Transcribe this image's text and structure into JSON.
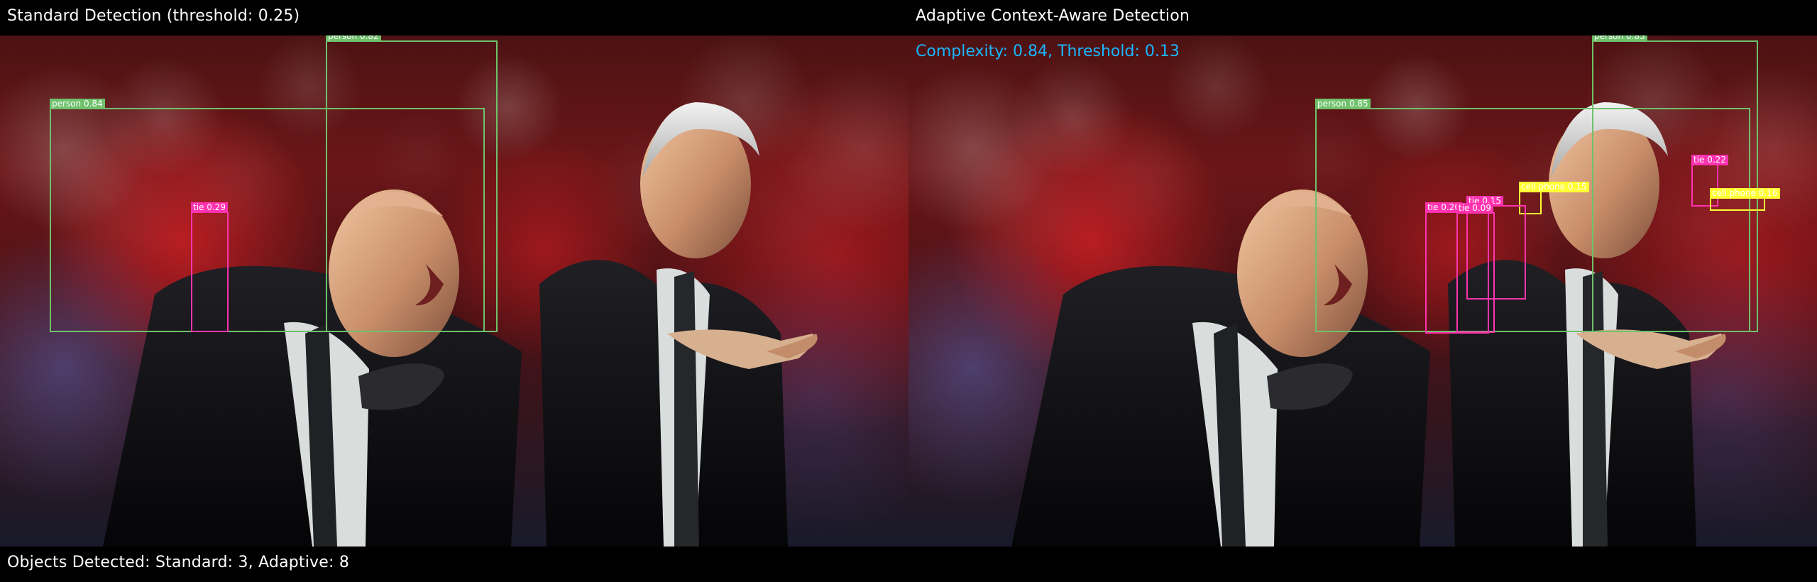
{
  "header": {
    "left_title": "Standard Detection (threshold: 0.25)",
    "right_title": "Adaptive Context-Aware Detection",
    "right_metrics": "Complexity: 0.84, Threshold: 0.13"
  },
  "footer": {
    "summary": "Objects Detected: Standard: 3, Adaptive: 8"
  },
  "standard_detections": [
    {
      "label": "person 0.82",
      "color": "#6fc16b"
    },
    {
      "label": "person 0.84",
      "color": "#6fc16b"
    },
    {
      "label": "tie 0.29",
      "color": "#ff33b0"
    }
  ],
  "adaptive_detections": [
    {
      "label": "person 0.85",
      "color": "#6fc16b"
    },
    {
      "label": "person 0.85",
      "color": "#6fc16b"
    },
    {
      "label": "tie 0.22",
      "color": "#ff33b0"
    },
    {
      "label": "cell phone 0.15",
      "color": "#ffff33"
    },
    {
      "label": "cell phone 0.16",
      "color": "#ffff33"
    },
    {
      "label": "tie 0.15",
      "color": "#ff33b0"
    },
    {
      "label": "tie 0.20",
      "color": "#ff33b0"
    },
    {
      "label": "tie 0.09",
      "color": "#ff33b0"
    }
  ],
  "colors": {
    "person": "#6fc16b",
    "tie": "#ff33b0",
    "cell_phone": "#ffff33",
    "metrics_text": "#19b7ff",
    "text": "#ffffff",
    "background": "#000000"
  }
}
